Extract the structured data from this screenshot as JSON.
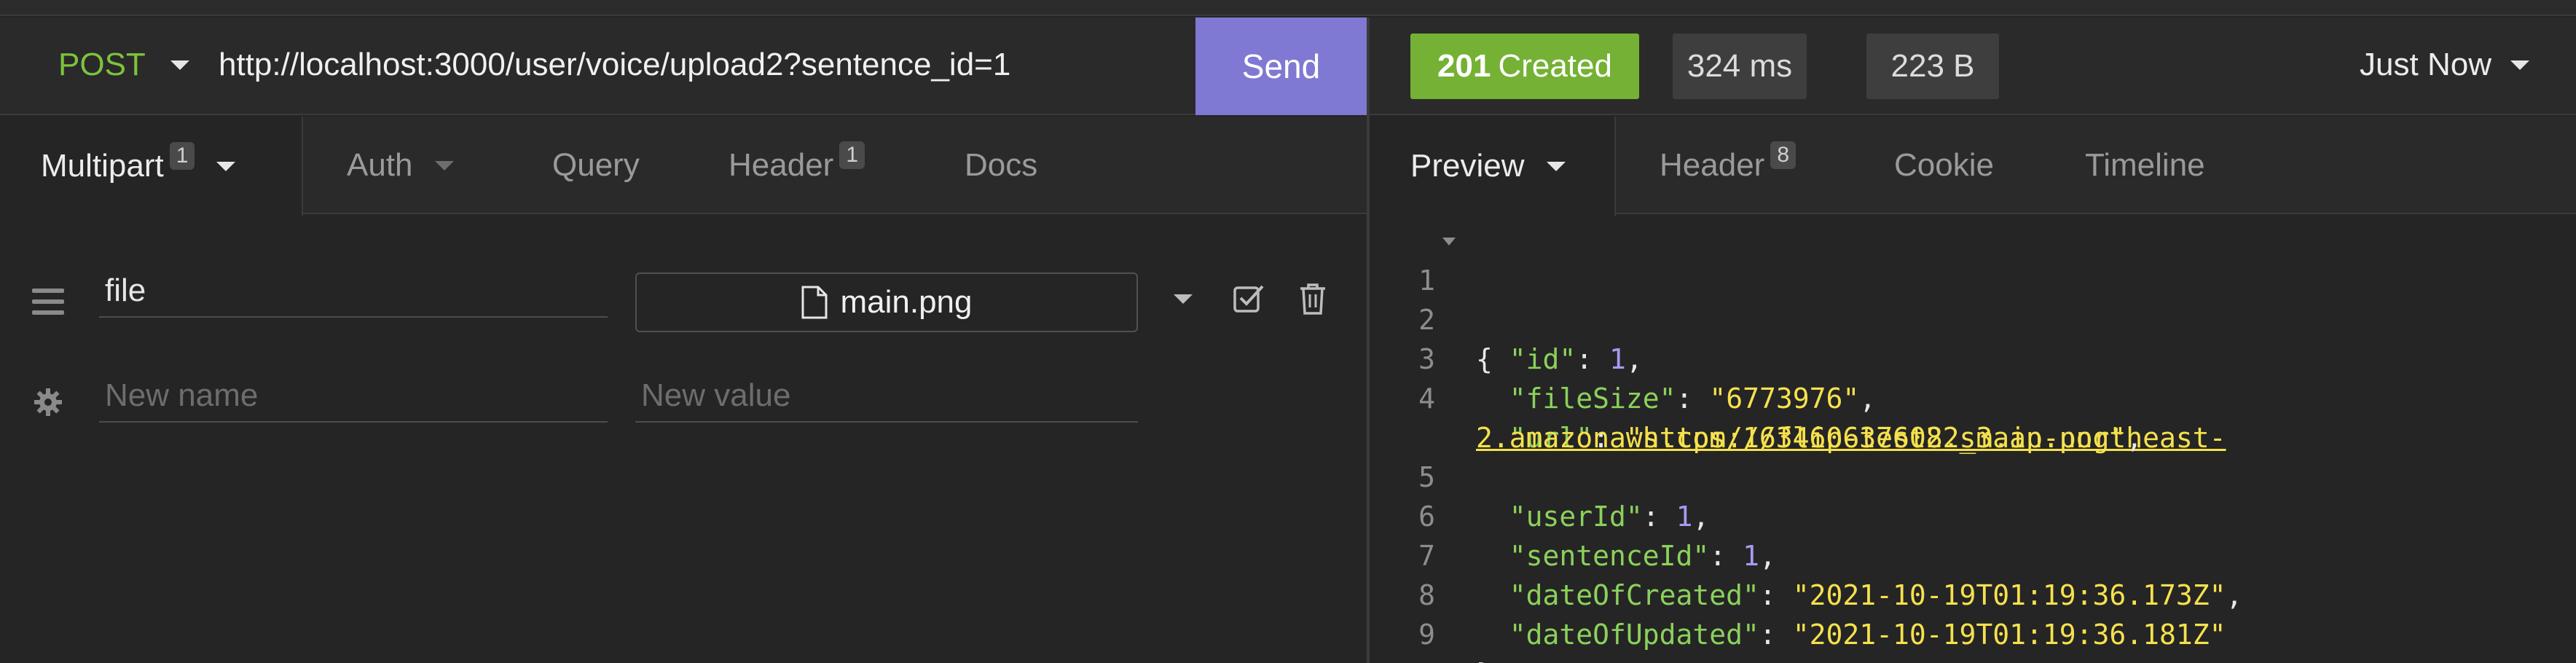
{
  "request": {
    "method": "POST",
    "url": "http://localhost:3000/user/voice/upload2?sentence_id=1",
    "send_label": "Send"
  },
  "request_tabs": [
    {
      "label": "Multipart",
      "badge": "1"
    },
    {
      "label": "Auth"
    },
    {
      "label": "Query"
    },
    {
      "label": "Header",
      "badge": "1"
    },
    {
      "label": "Docs"
    }
  ],
  "multipart": {
    "row1": {
      "name": "file",
      "file_name": "main.png"
    },
    "new_row": {
      "name_placeholder": "New name",
      "value_placeholder": "New value"
    }
  },
  "response": {
    "status_code": "201",
    "status_text": "Created",
    "time": "324 ms",
    "size": "223 B",
    "history_label": "Just Now"
  },
  "response_tabs": [
    {
      "label": "Preview"
    },
    {
      "label": "Header",
      "badge": "8"
    },
    {
      "label": "Cookie"
    },
    {
      "label": "Timeline"
    }
  ],
  "body": {
    "line_numbers": [
      "1",
      "2",
      "3",
      "4",
      "5",
      "6",
      "7",
      "8",
      "9"
    ],
    "open_brace": "{",
    "close_brace": "}",
    "fields": {
      "id_key": "\"id\"",
      "id_val": "1",
      "fileSize_key": "\"fileSize\"",
      "fileSize_val": "\"6773976\"",
      "url_key": "\"url\"",
      "url_val_part1": "https://flip-test2.s3.ap-northeast-",
      "url_val_part2": "2.amazonaws.com/1634606376082_main.png",
      "userId_key": "\"userId\"",
      "userId_val": "1",
      "sentenceId_key": "\"sentenceId\"",
      "sentenceId_val": "1",
      "dateOfCreated_key": "\"dateOfCreated\"",
      "dateOfCreated_val": "\"2021-10-19T01:19:36.173Z\"",
      "dateOfUpdated_key": "\"dateOfUpdated\"",
      "dateOfUpdated_val": "\"2021-10-19T01:19:36.181Z\""
    }
  },
  "colors": {
    "method": "#7dc33b",
    "send_button": "#7f79d3",
    "status_ok": "#75b134",
    "json_key": "#8bd15c",
    "json_string": "#f5e14c",
    "json_number": "#a59bf0"
  },
  "icons": [
    "chevron-down-icon",
    "drag-handle-icon",
    "gear-icon",
    "file-icon",
    "checkbox-icon",
    "trash-icon"
  ]
}
